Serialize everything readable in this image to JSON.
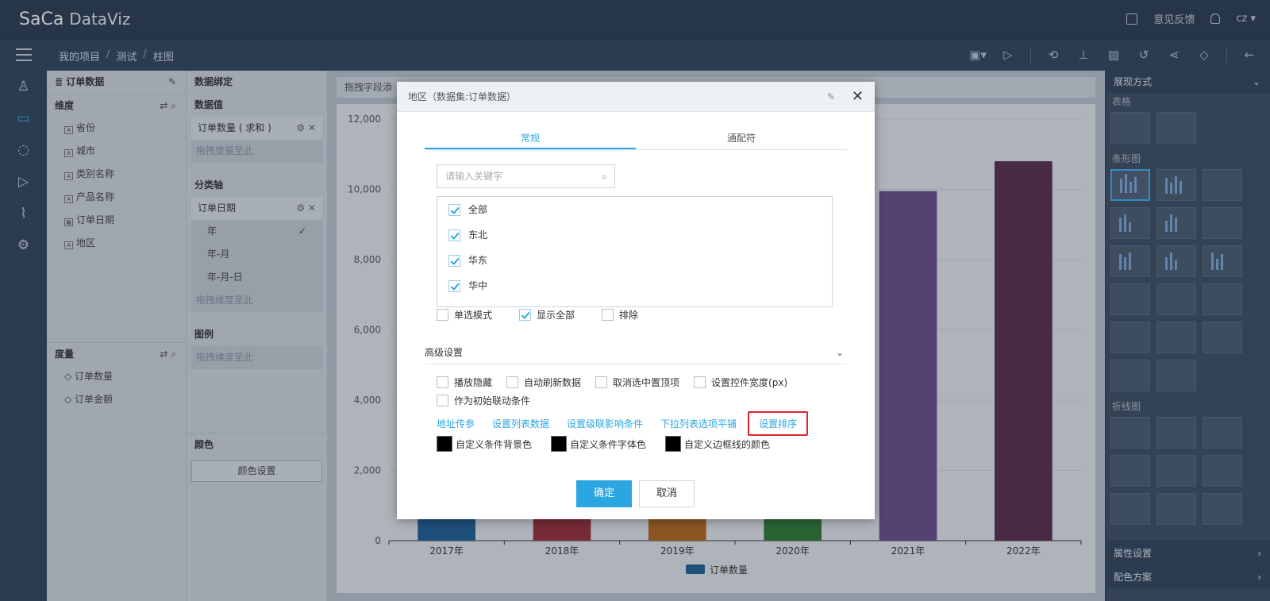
{
  "app": {
    "logo_main": "Sa",
    "logo_mid": "Ca",
    "logo_sub": "DataViz"
  },
  "topbar": {
    "feedback": "意见反馈",
    "user": "cz"
  },
  "breadcrumb": [
    "我的项目",
    "测试",
    "柱图"
  ],
  "left_panel": {
    "dataset_title": "订单数据",
    "dimension_header": "维度",
    "dimensions": [
      "省份",
      "城市",
      "类别名称",
      "产品名称",
      "订单日期",
      "地区"
    ],
    "measure_header": "度量",
    "measures": [
      "订单数量",
      "订单金额"
    ]
  },
  "binding_panel": {
    "title": "数据绑定",
    "values_header": "数据值",
    "value_item": "订单数量 ( 求和 )",
    "value_hint": "拖拽度量至此",
    "axis_header": "分类轴",
    "axis_item": "订单日期",
    "axis_options": [
      "年",
      "年-月",
      "年-月-日"
    ],
    "axis_selected": "年",
    "axis_hint": "拖拽维度至此",
    "legend_header": "图例",
    "legend_hint": "拖拽维度至此",
    "color_header": "颜色",
    "color_button": "颜色设置"
  },
  "canvas": {
    "drag_hint": "拖拽字段添"
  },
  "chart_data": {
    "type": "bar",
    "categories": [
      "2017年",
      "2018年",
      "2019年",
      "2020年",
      "2021年",
      "2022年"
    ],
    "series": [
      {
        "name": "订单数量",
        "values": [
          1000,
          1000,
          1000,
          1000,
          9950,
          10800
        ]
      }
    ],
    "colors": [
      "#1f5f96",
      "#9a2d37",
      "#b7681d",
      "#2f7a34",
      "#6b4c8a",
      "#5a2c4a"
    ],
    "ylim": [
      0,
      12000
    ],
    "yticks": [
      "0",
      "2,000",
      "4,000",
      "6,000",
      "8,000",
      "10,000",
      "12,000"
    ],
    "grid": true,
    "legend_position": "bottom-center"
  },
  "right_panel": {
    "title": "展现方式",
    "table_label": "表格",
    "bar_label": "条形图",
    "line_label": "折线图",
    "property_settings": "属性设置",
    "color_scheme": "配色方案"
  },
  "dialog": {
    "title": "地区（数据集:订单数据）",
    "tabs": [
      "常规",
      "通配符"
    ],
    "active_tab": "常规",
    "search_placeholder": "请输入关键字",
    "items": [
      {
        "label": "全部",
        "checked": true
      },
      {
        "label": "东北",
        "checked": true
      },
      {
        "label": "华东",
        "checked": true
      },
      {
        "label": "华中",
        "checked": true
      }
    ],
    "mode_options": [
      {
        "label": "单选模式",
        "checked": false
      },
      {
        "label": "显示全部",
        "checked": true
      },
      {
        "label": "排除",
        "checked": false
      }
    ],
    "advanced_label": "高级设置",
    "advanced_options": [
      {
        "label": "播放隐藏",
        "checked": false
      },
      {
        "label": "自动刷新数据",
        "checked": false
      },
      {
        "label": "取消选中置顶项",
        "checked": false
      },
      {
        "label": "设置控件宽度(px)",
        "checked": false
      },
      {
        "label": "作为初始联动条件",
        "checked": false
      }
    ],
    "links": [
      "地址传参",
      "设置列表数据",
      "设置级联影响条件",
      "下拉列表选项平铺",
      "设置排序"
    ],
    "color_settings": [
      "自定义条件背景色",
      "自定义条件字体色",
      "自定义边框线的颜色"
    ],
    "ok": "确定",
    "cancel": "取消"
  }
}
